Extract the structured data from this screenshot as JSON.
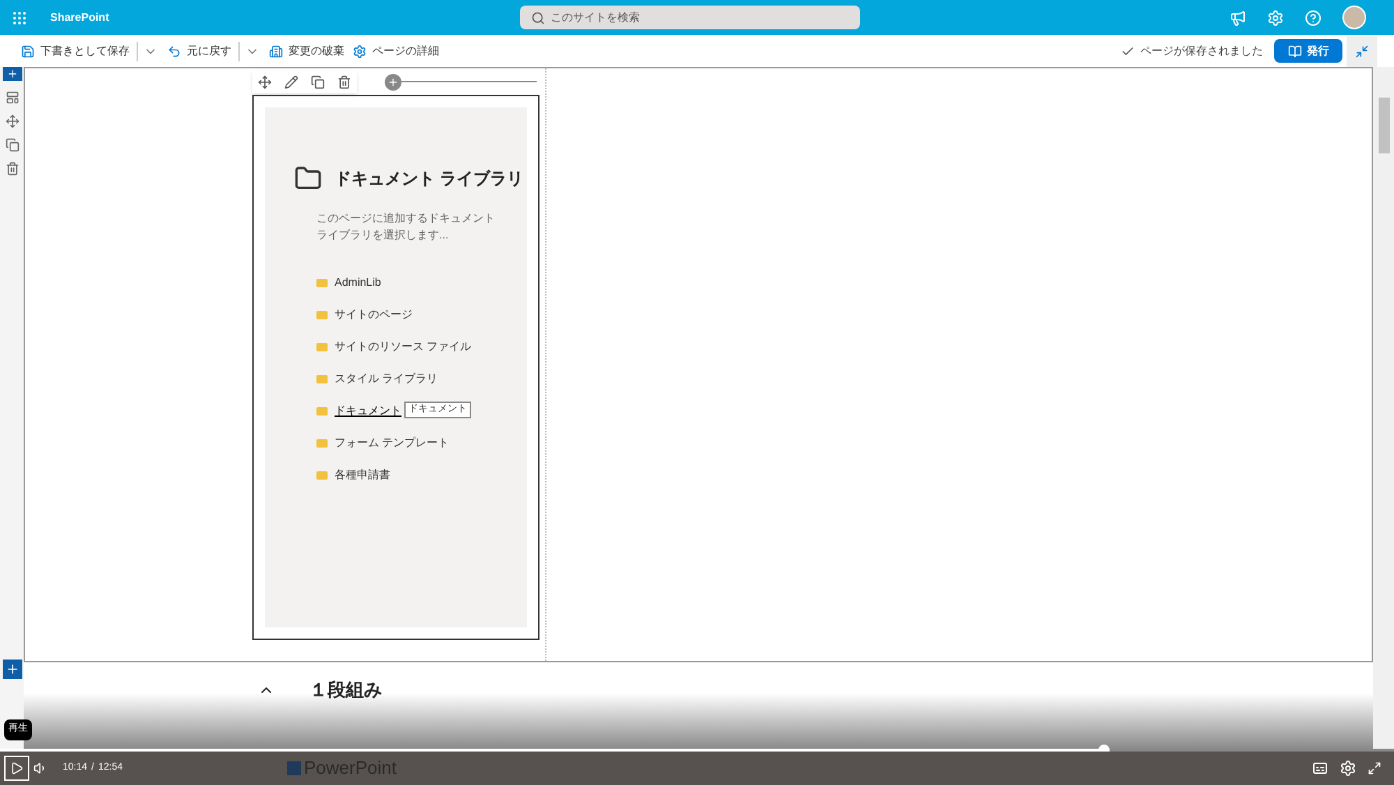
{
  "top_bar": {
    "app_name": "SharePoint",
    "search": {
      "placeholder": "このサイトを検索"
    }
  },
  "command_bar": {
    "left": [
      {
        "label": "下書きとして保存",
        "kind": "save",
        "has_dropdown": true
      },
      {
        "label": "元に戻す",
        "kind": "undo",
        "has_dropdown": true
      },
      {
        "label": "変更の破棄",
        "kind": "discard",
        "has_dropdown": false
      },
      {
        "label": "ページの詳細",
        "kind": "details",
        "has_dropdown": false
      }
    ],
    "status": "ページが保存されました",
    "publish": "発行"
  },
  "web_part": {
    "title": "ドキュメント ライブラリ",
    "description": "このページに追加するドキュメントライブラリを選択します...",
    "libraries": [
      {
        "label": "AdminLib",
        "hovered": false
      },
      {
        "label": "サイトのページ",
        "hovered": false
      },
      {
        "label": "サイトのリソース ファイル",
        "hovered": false
      },
      {
        "label": "スタイル ライブラリ",
        "hovered": false
      },
      {
        "label": "ドキュメント",
        "hovered": true
      },
      {
        "label": "フォーム テンプレート",
        "hovered": false
      },
      {
        "label": "各種申請書",
        "hovered": false
      }
    ],
    "tooltip": "ドキュメント"
  },
  "section": {
    "title": "１段組み",
    "expanded": true
  },
  "video_player": {
    "tooltip": "再生",
    "current_time": "10:14",
    "separator": "/",
    "duration": "12:54",
    "progress": {
      "level": 0.792
    },
    "watermark": "PowerPoint"
  }
}
